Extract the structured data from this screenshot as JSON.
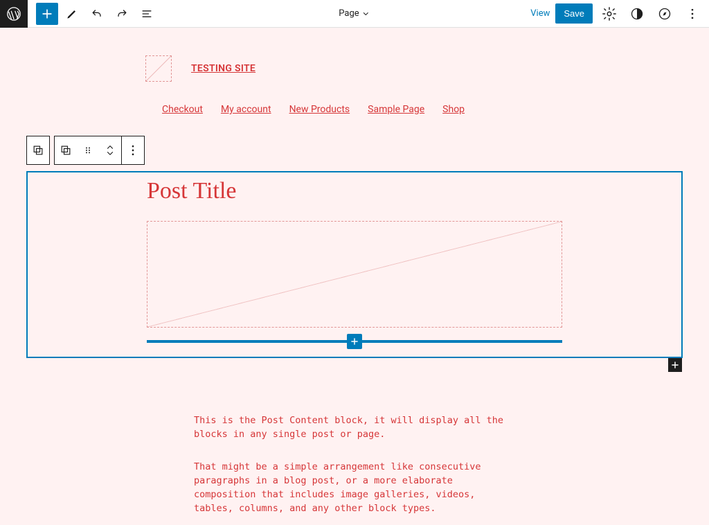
{
  "toolbar": {
    "doc_type": "Page",
    "view_label": "View",
    "save_label": "Save"
  },
  "site": {
    "title": "TESTING SITE",
    "nav": [
      "Checkout",
      "My account",
      "New Products",
      "Sample Page",
      "Shop"
    ]
  },
  "block": {
    "post_title": "Post Title"
  },
  "content": {
    "p1": "This is the Post Content block, it will display all the blocks in any single post or page.",
    "p2": "That might be a simple arrangement like consecutive paragraphs in a blog post, or a more elaborate composition that includes image galleries, videos, tables, columns, and any other block types."
  }
}
